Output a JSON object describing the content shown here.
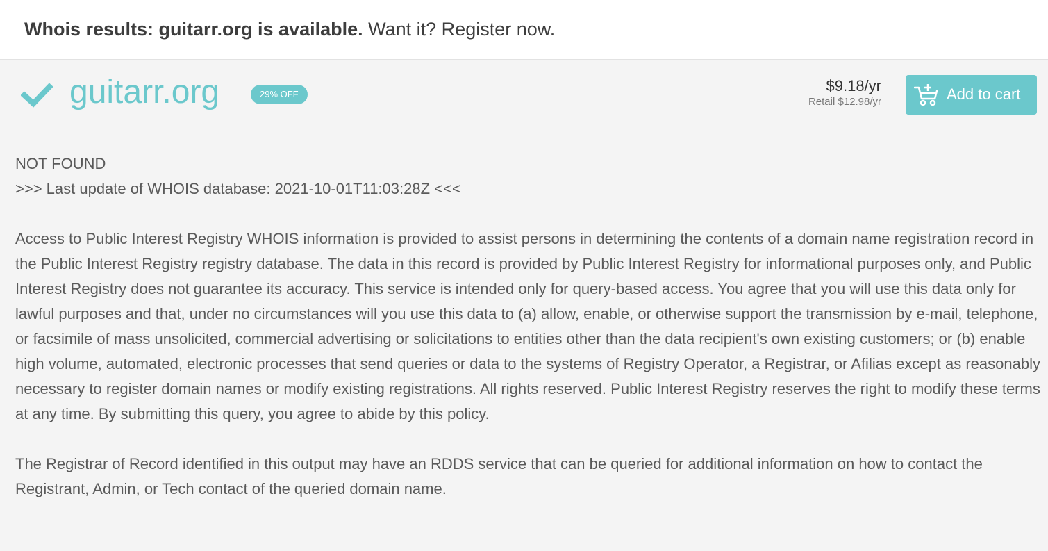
{
  "header": {
    "bold_text": "Whois results: guitarr.org is available.",
    "normal_text": " Want it? Register now."
  },
  "domain": {
    "name": "guitarr.org",
    "status_icon": "check-icon",
    "badge": "29% OFF",
    "price": "$9.18/yr",
    "retail": "Retail $12.98/yr",
    "cart_icon": "add-to-cart-icon",
    "cart_label": "Add to cart"
  },
  "whois": {
    "status": "NOT FOUND",
    "last_update": ">>> Last update of WHOIS database: 2021-10-01T11:03:28Z <<<",
    "terms": "Access to Public Interest Registry WHOIS information is provided to assist persons in determining the contents of a domain name registration record in the Public Interest Registry registry database. The data in this record is provided by Public Interest Registry for informational purposes only, and Public Interest Registry does not guarantee its accuracy. This service is intended only for query-based access. You agree that you will use this data only for lawful purposes and that, under no circumstances will you use this data to (a) allow, enable, or otherwise support the transmission by e-mail, telephone, or facsimile of mass unsolicited, commercial advertising or solicitations to entities other than the data recipient's own existing customers; or (b) enable high volume, automated, electronic processes that send queries or data to the systems of Registry Operator, a Registrar, or Afilias except as reasonably necessary to register domain names or modify existing registrations. All rights reserved. Public Interest Registry reserves the right to modify these terms at any time. By submitting this query, you agree to abide by this policy.",
    "rdds_note": "The Registrar of Record identified in this output may have an RDDS service that can be queried for additional information on how to contact the Registrant, Admin, or Tech contact of the queried domain name."
  },
  "colors": {
    "accent": "#6bc8cc",
    "text": "#5a5a5a",
    "background": "#f4f4f4"
  }
}
